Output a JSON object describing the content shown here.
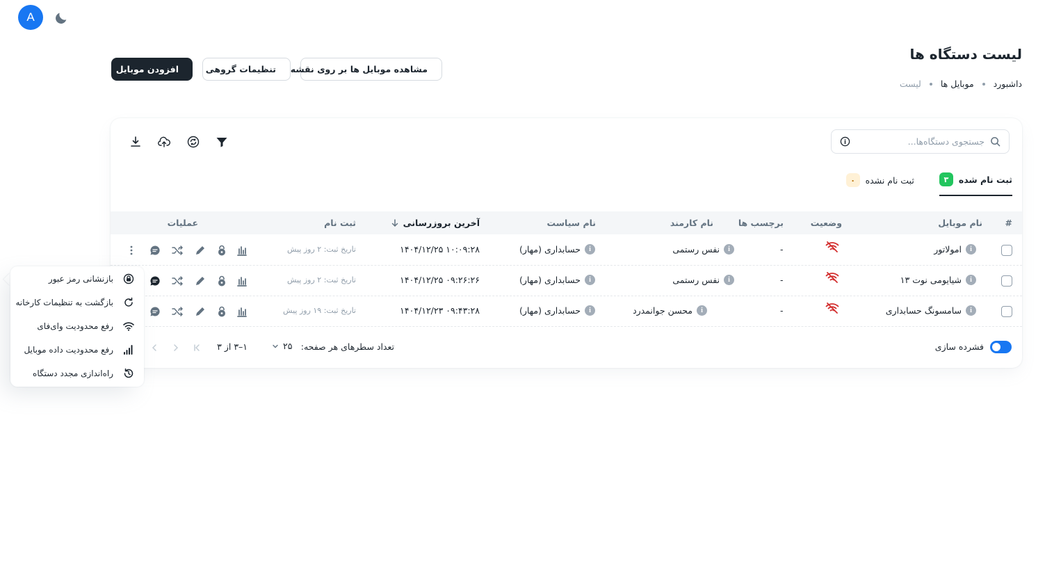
{
  "topbar": {
    "avatar_letter": "A"
  },
  "header": {
    "title": "لیست دستگاه ها",
    "breadcrumb": [
      "داشبورد",
      "موبایل ها",
      "لیست"
    ],
    "buttons": {
      "map": "مشاهده موبایل ها بر روی نقشه",
      "group": "تنظیمات گروهی",
      "add": "افزودن موبایل"
    }
  },
  "search": {
    "placeholder": "جستجوی دستگاه‌ها..."
  },
  "tabs": [
    {
      "label": "ثبت نام شده",
      "count": "۳",
      "active": true
    },
    {
      "label": "ثبت نام نشده",
      "count": "۰",
      "active": false
    }
  ],
  "table": {
    "headers": {
      "hash": "#",
      "name": "نام موبایل",
      "status": "وضعیت",
      "tags": "برچسب ها",
      "employee": "نام کارمند",
      "policy": "نام سیاست",
      "last_update": "آخرین بروزرسانی",
      "register": "ثبت نام",
      "ops": "عملیات"
    },
    "rows": [
      {
        "name": "امولاتور",
        "tags": "-",
        "employee": "نفس رستمی",
        "policy": "حسابداری  (مهار)",
        "last_update": "۱۴۰۴/۱۲/۲۵ ۱۰:۰۹:۲۸",
        "register": "تاریخ ثبت: ۲ روز پیش"
      },
      {
        "name": "شیایومی نوت ۱۳",
        "tags": "-",
        "employee": "نفس رستمی",
        "policy": "حسابداری  (مهار)",
        "last_update": "۱۴۰۴/۱۲/۲۵ ۰۹:۲۶:۲۶",
        "register": "تاریخ ثبت: ۲ روز پیش"
      },
      {
        "name": "سامسونگ حسابداری",
        "tags": "-",
        "employee": "محسن جوانمدرد",
        "policy": "حسابداری  (مهار)",
        "last_update": "۱۴۰۴/۱۲/۲۳ ۰۹:۴۳:۲۸",
        "register": "تاریخ ثبت: ۱۹ روز پیش"
      }
    ]
  },
  "footer": {
    "dense_label": "فشرده سازی",
    "rows_per_page_label": "تعداد سطرهای هر صفحه:",
    "rows_per_page": "۲۵",
    "range": "۱–۳ از ۳"
  },
  "menu": [
    {
      "label": "بازنشانی رمز عبور",
      "icon": "lock-reset-icon"
    },
    {
      "label": "بازگشت به تنظیمات کارخانه",
      "icon": "refresh-icon"
    },
    {
      "label": "رفع محدودیت وای‌فای",
      "icon": "wifi-icon"
    },
    {
      "label": "رفع محدودیت داده موبایل",
      "icon": "signal-icon"
    },
    {
      "label": "راه‌اندازی مجدد دستگاه",
      "icon": "restart-icon"
    }
  ],
  "colors": {
    "primary": "#1877f2",
    "dark": "#1c252e",
    "success": "#22c55e",
    "error": "#d32f2f",
    "muted": "#919eab"
  }
}
